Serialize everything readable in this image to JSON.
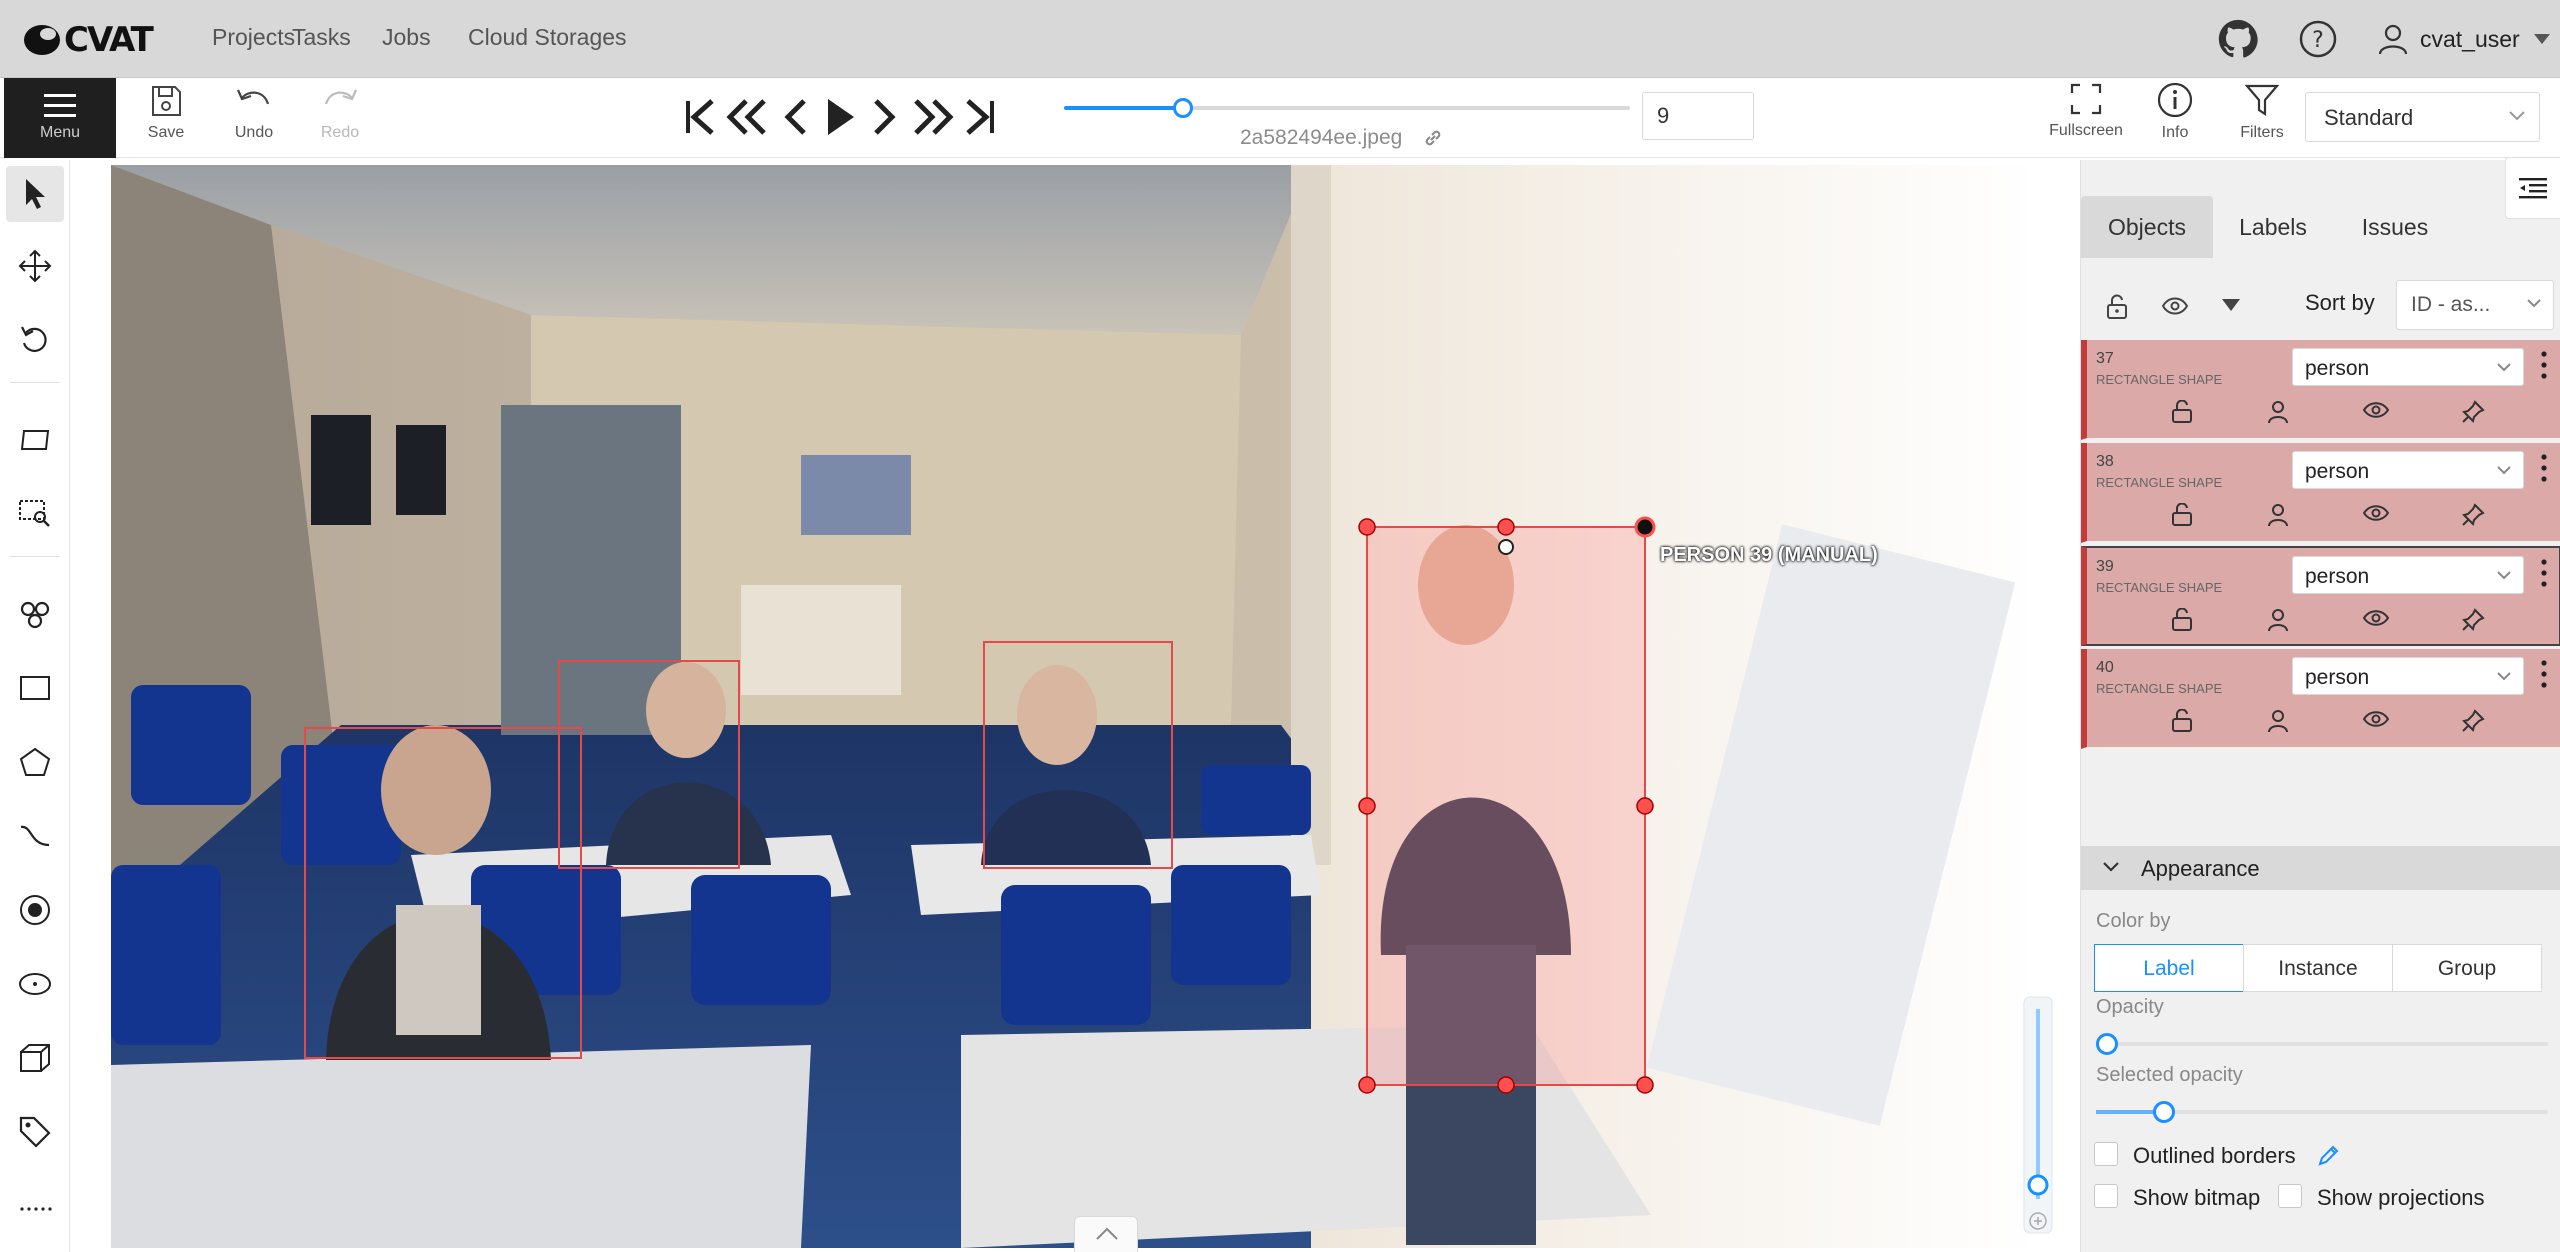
{
  "header": {
    "logo_text": "CVAT",
    "nav": [
      "Projects",
      "Tasks",
      "Jobs",
      "Cloud Storages"
    ],
    "user": "cvat_user"
  },
  "toolbar": {
    "menu_label": "Menu",
    "save_label": "Save",
    "undo_label": "Undo",
    "redo_label": "Redo",
    "frame_number": "9",
    "frame_filename": "2a582494ee.jpeg",
    "frame_slider_fraction": 0.21,
    "fullscreen_label": "Fullscreen",
    "info_label": "Info",
    "filters_label": "Filters",
    "workspace": "Standard"
  },
  "canvas": {
    "active_label": "PERSON 39 (MANUAL)"
  },
  "sidebar": {
    "tabs": [
      "Objects",
      "Labels",
      "Issues"
    ],
    "sort_label": "Sort by",
    "sort_value": "ID - as...",
    "objects": [
      {
        "id": "37",
        "type": "RECTANGLE SHAPE",
        "label": "person"
      },
      {
        "id": "38",
        "type": "RECTANGLE SHAPE",
        "label": "person"
      },
      {
        "id": "39",
        "type": "RECTANGLE SHAPE",
        "label": "person"
      },
      {
        "id": "40",
        "type": "RECTANGLE SHAPE",
        "label": "person"
      }
    ],
    "appearance": {
      "title": "Appearance",
      "color_by_label": "Color by",
      "color_by_options": [
        "Label",
        "Instance",
        "Group"
      ],
      "color_by_selected": "Label",
      "opacity_label": "Opacity",
      "opacity_fraction": 0.0,
      "selected_opacity_label": "Selected opacity",
      "selected_opacity_fraction": 0.15,
      "outlined_borders_label": "Outlined borders",
      "show_bitmap_label": "Show bitmap",
      "show_projections_label": "Show projections"
    }
  },
  "colors": {
    "accent": "#1890ff",
    "annotation": "#e54a4a",
    "object_row": "#dca9a9"
  }
}
